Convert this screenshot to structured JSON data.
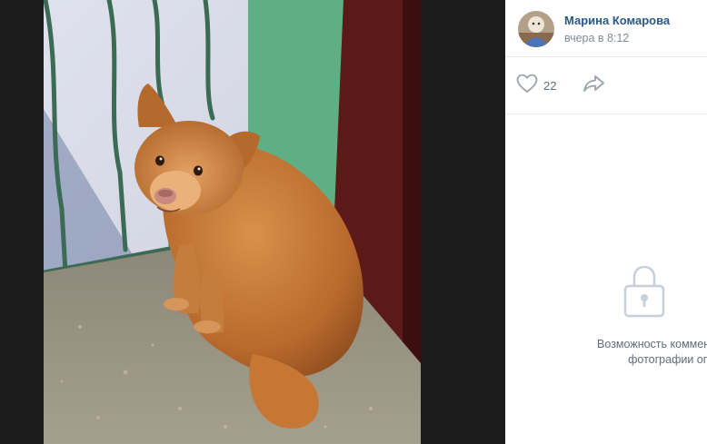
{
  "author": {
    "name": "Марина Комарова",
    "date": "вчера в 8:12"
  },
  "actions": {
    "like_count": "22"
  },
  "comments": {
    "closed_line1": "Возможность комментирования этой",
    "closed_line2": "фотографии ограничена."
  },
  "icons": {
    "like": "heart-icon",
    "share": "share-arrow-icon",
    "lock": "lock-icon"
  },
  "colors": {
    "link": "#2a5885",
    "muted": "#818c99",
    "icon": "#99a2ad",
    "backdrop": "#1b1b1c"
  }
}
